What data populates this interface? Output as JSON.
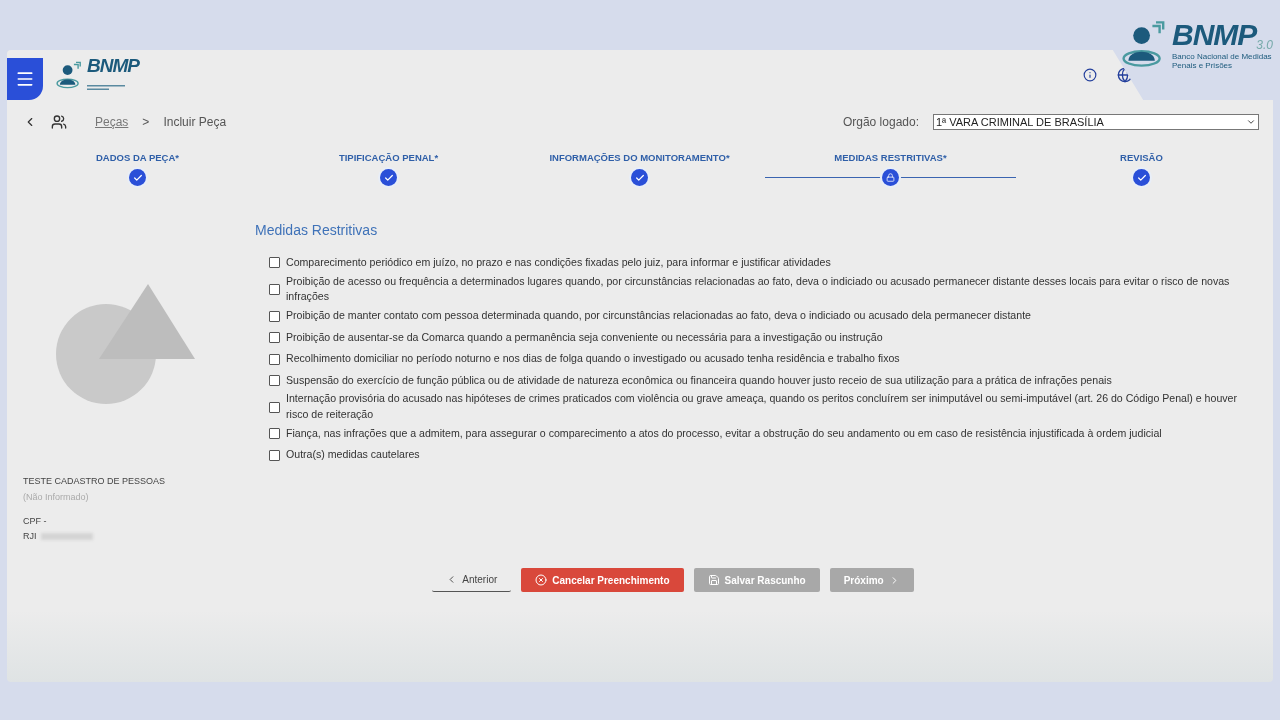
{
  "header": {
    "logo": {
      "text": "BNMP"
    }
  },
  "corner_logo": {
    "text": "BNMP",
    "version": "3.0",
    "subtitle": "Banco Nacional de Medidas Penais e Prisões"
  },
  "breadcrumb": {
    "items": [
      {
        "label": "Peças"
      },
      {
        "label": "Incluir Peça"
      }
    ],
    "separator": ">"
  },
  "orgao": {
    "label": "Orgão logado:",
    "value": "1ª VARA CRIMINAL DE BRASÍLIA"
  },
  "steps": [
    {
      "label": "DADOS DA PEÇA*",
      "done": true
    },
    {
      "label": "TIPIFICAÇÃO PENAL*",
      "done": true
    },
    {
      "label": "INFORMAÇÕES DO MONITORAMENTO*",
      "done": true
    },
    {
      "label": "MEDIDAS RESTRITIVAS*",
      "done": false
    },
    {
      "label": "REVISÃO",
      "done": true
    }
  ],
  "person": {
    "name": "TESTE CADASTRO DE PESSOAS",
    "note": "(Não Informado)",
    "cpf": "CPF -",
    "rji": "RJI"
  },
  "section_title": "Medidas Restritivas",
  "measures": [
    {
      "label": "Comparecimento periódico em juízo, no prazo e nas condições fixadas pelo juiz, para informar e justificar atividades",
      "checked": false
    },
    {
      "label": " Proibição de acesso ou frequência a determinados lugares quando, por circunstâncias relacionadas ao fato, deva o indiciado ou acusado permanecer distante desses locais para evitar o risco de novas infrações",
      "checked": false
    },
    {
      "label": "Proibição de manter contato com pessoa determinada quando, por circunstâncias relacionadas ao fato, deva o indiciado ou acusado dela permanecer distante",
      "checked": false
    },
    {
      "label": "Proibição de ausentar-se da Comarca quando a permanência seja conveniente ou necessária para a investigação ou instrução",
      "checked": false
    },
    {
      "label": "Recolhimento domiciliar no período noturno e nos dias de folga quando o investigado ou acusado tenha residência e trabalho fixos",
      "checked": false
    },
    {
      "label": "Suspensão do exercício de função pública ou de atividade de natureza econômica ou financeira quando houver justo receio de sua utilização para a prática de infrações penais",
      "checked": false
    },
    {
      "label": " Internação provisória do acusado nas hipóteses de crimes praticados com violência ou grave ameaça, quando os peritos concluírem ser inimputável ou semi-imputável (art. 26 do Código Penal) e houver risco de reiteração",
      "checked": false
    },
    {
      "label": "Fiança, nas infrações que a admitem, para assegurar o comparecimento a atos do processo, evitar a obstrução do seu andamento ou em caso de resistência injustificada à ordem judicial",
      "checked": false
    },
    {
      "label": "Outra(s) medidas cautelares",
      "checked": false
    }
  ],
  "buttons": [
    {
      "kind": "back",
      "label": "Anterior",
      "disabled": false
    },
    {
      "kind": "cancel",
      "label": "Cancelar Preenchimento",
      "disabled": false
    },
    {
      "kind": "save",
      "label": "Salvar Rascunho",
      "disabled": true
    },
    {
      "kind": "next",
      "label": "Próximo",
      "disabled": true
    }
  ]
}
